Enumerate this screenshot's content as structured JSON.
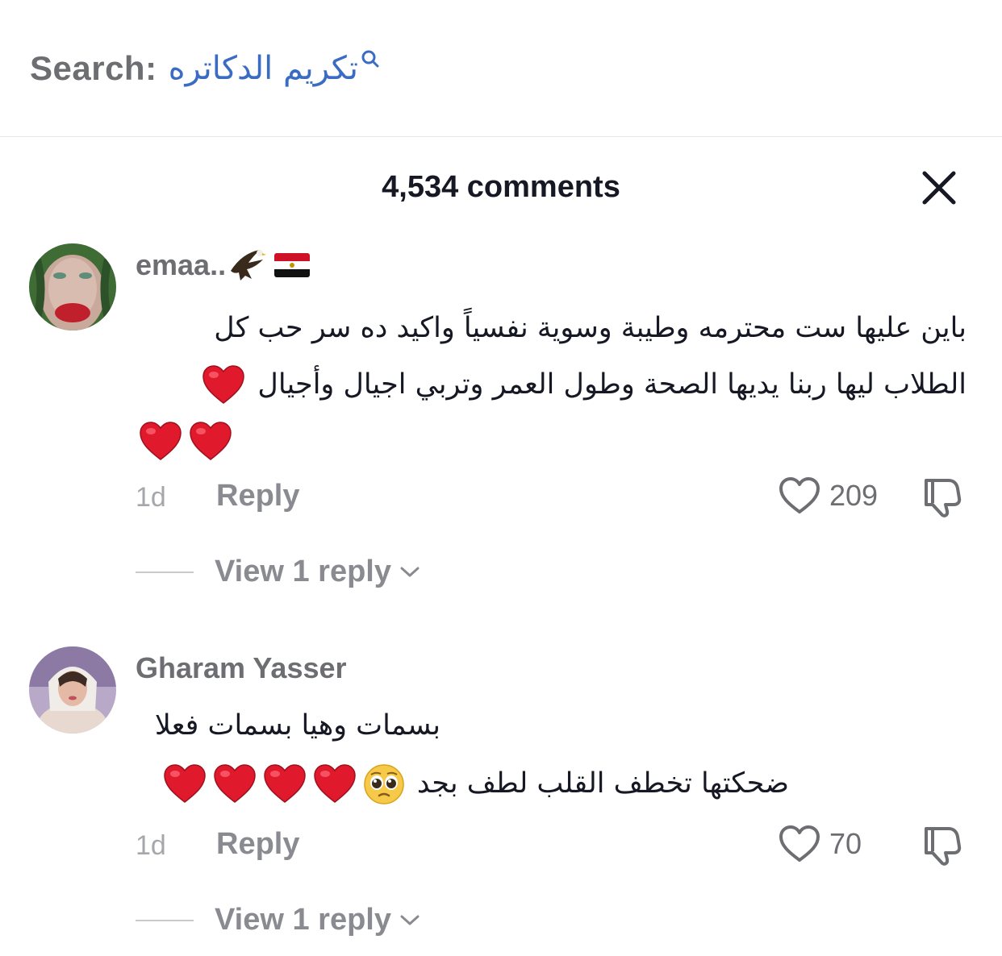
{
  "search": {
    "label": "Search:",
    "query": "تكريم الدكاتره"
  },
  "header": {
    "title": "4,534 comments",
    "close_icon": "close-icon"
  },
  "comments": [
    {
      "username": "emaa..",
      "username_emoji": [
        "eagle-emoji",
        "egypt-flag-emoji"
      ],
      "lines": [
        "باين عليها ست محترمه وطيبة وسوية نفسياً واكيد ده سر حب كل",
        "الطلاب ليها ربنا يديها الصحة وطول العمر وتربي اجيال وأجيال"
      ],
      "line2_emoji": "red-heart-emoji",
      "line3_emoji_count": 2,
      "time": "1d",
      "reply_label": "Reply",
      "likes": "209",
      "view_replies": "View 1 reply"
    },
    {
      "username": "Gharam Yasser",
      "lines": [
        "بسمات وهيا بسمات فعلا",
        "ضحكتها تخطف القلب لطف بجد"
      ],
      "line2_emoji": [
        "pleading-face-emoji",
        "red-heart-emoji",
        "red-heart-emoji",
        "red-heart-emoji",
        "red-heart-emoji"
      ],
      "time": "1d",
      "reply_label": "Reply",
      "likes": "70",
      "view_replies": "View 1 reply"
    }
  ],
  "colors": {
    "query": "#3b6cc4",
    "muted": "#6d6e72",
    "meta": "#a6a7ab",
    "text": "#161823",
    "heart_red": "#e0192c"
  }
}
